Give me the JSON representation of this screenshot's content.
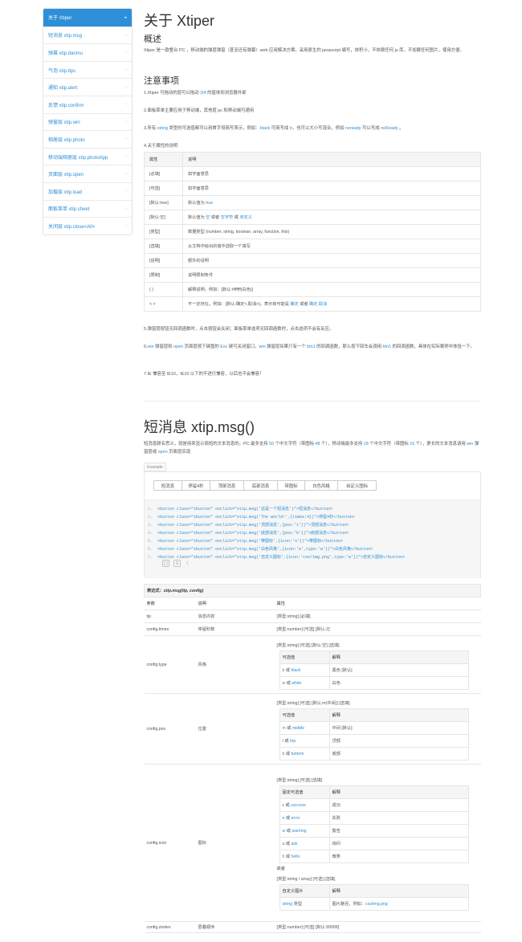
{
  "sidebar": {
    "items": [
      {
        "label": "关于 Xtiper",
        "active": true
      },
      {
        "label": "短消息 xtip.msg"
      },
      {
        "label": "弹幕 xtip.danmu"
      },
      {
        "label": "气泡 xtip.tips"
      },
      {
        "label": "通知 xtip.alert"
      },
      {
        "label": "反馈 xtip.confirm"
      },
      {
        "label": "弹窗层 xtip.win"
      },
      {
        "label": "相册层 xtip.photo"
      },
      {
        "label": "移动端相册层 xtip.photoApp"
      },
      {
        "label": "页面层 xtip.open"
      },
      {
        "label": "加载层 xtip.load"
      },
      {
        "label": "面板菜单 xtip.sheet"
      },
      {
        "label": "关闭层 xtip.close<All>"
      }
    ],
    "chevron": "chevron-right-icon"
  },
  "about": {
    "title": "关于 Xtiper",
    "overview_heading": "概述",
    "overview_text": "Xtiper 是一款整合 PC ，移动端的弹层弹窗（甚至还有弹幕）web 应用解决方案。采用原生的 javascript 编写，体积小，不依赖任何 js 库，不加载任何图片，使用方便。",
    "notes_heading": "注意事项",
    "note1_a": "1.Xtiper 可拖动的层可以拖动 ",
    "note1_b": "3/4",
    "note1_c": " 的窗体到浏览器外部",
    "note2": "2.面板菜单主要应用于移动端，其他层 pc 和移动端可通用",
    "note3_a": "3.所有 ",
    "note3_b": "string",
    "note3_c": " 类型的可选值都可以用首字母简写表示，例如：",
    "note3_d": "black",
    "note3_e": " 可简写成 ",
    "note3_f": "b",
    "note3_g": "，也可以大小写混合，例如 ",
    "note3_h": "noready",
    "note3_i": " 可以写成 ",
    "note3_j": "noReady",
    "note3_k": " 。",
    "note4": "4.关于属性的说明",
    "props_header": [
      "属性",
      "说明"
    ],
    "props": [
      {
        "k": "[必填]",
        "v": "如字面意思"
      },
      {
        "k": "[可选]",
        "v": "如字面意思"
      },
      {
        "k": "[默认:true]",
        "v_pre": "默认值为 ",
        "v_link": "true"
      },
      {
        "k": "[默认:空]",
        "v_pre": "默认值为 ",
        "v_link": "空",
        "v_mid": " 或者 ",
        "v_link2": "空字符",
        "v_mid2": " 或 ",
        "v_link3": "未定义"
      },
      {
        "k": "[类型]",
        "v": "数据类型 (number, string, boolean, array, function, this)"
      },
      {
        "k": "[选填]",
        "v": "从文档中给出的值中选取一个填写"
      },
      {
        "k": "[说明]",
        "v": "额外的说明"
      },
      {
        "k": "[限制]",
        "v": "说明限制条件"
      },
      {
        "k": "( )",
        "v": "解释说明，例如：[默认:#ffffff(白色)]"
      },
      {
        "k": "< >",
        "v_pre": "不一定存在。例如：[默认:确定<,取消>]，表示有可能是 ",
        "v_link": "确定",
        "v_mid": " 或者 ",
        "v_link2": "确定,取消"
      }
    ],
    "note5": "5.弹窗层按钮无回调函数时，点击按钮会关闭；面板菜单选项无回调函数时，点击选项不会有反应。",
    "note6_a": "6.",
    "note6_b": "win",
    "note6_c": " 弹窗层和 ",
    "note6_d": "open",
    "note6_e": " 页面层按下键盘的 ",
    "note6_f": "Esc",
    "note6_g": " 键可关闭窗口，",
    "note6_h": "win",
    "note6_i": " 弹窗层如果只有一个 ",
    "note6_j": "btn1",
    "note6_k": " 的回调函数，那么按下回车会调用 ",
    "note6_l": "btn1",
    "note6_m": " 的回调函数，具体在实际案例中体验一下。",
    "note7": "7.IE 兼容至 IE10，IE10 以下的不进行兼容，以后也不会兼容！"
  },
  "msg": {
    "title": "短消息 xtip.msg()",
    "desc_a": "短消息顾名思义，就是用来显示简短的文本消息的。PC 最多支持 ",
    "desc_b": "50",
    "desc_c": " 个中文字符（带图标 ",
    "desc_d": "48",
    "desc_e": " 个），移动端最多支持 ",
    "desc_f": "18",
    "desc_g": " 个中文字符（带图标 ",
    "desc_h": "16",
    "desc_i": " 个），更长的文本消息请用 ",
    "desc_j": "win",
    "desc_k": " 弹窗层或 ",
    "desc_l": "open",
    "desc_m": " 页面层实现",
    "example_label": "Example",
    "buttons": [
      "短消息",
      "停留4秒",
      "顶部消息",
      "底部消息",
      "带图标",
      "白色风格",
      "自定义图标"
    ],
    "code": [
      "<button class=\"xbutton\" onclick=\"xtip.msg('这是一个短消息')\">短消息</button>",
      "<button class=\"xbutton\" onclick=\"xtip.msg('The world!',{times:4})\">停留4秒</button>",
      "<button class=\"xbutton\" onclick=\"xtip.msg('顶部消息',{pos:'t'})\">顶部消息</button>",
      "<button class=\"xbutton\" onclick=\"xtip.msg('底部消息',{pos:'b'})\">底部消息</button>",
      "<button class=\"xbutton\" onclick=\"xtip.msg('带图标',{icon:'s'})\">带图标</button>",
      "<button class=\"xbutton\" onclick=\"xtip.msg('白色风格',{icon:'e',type:'w'})\">白色风格</button>",
      "<button class=\"xbutton\" onclick=\"xtip.msg('自定义图标',{icon:'css/img.png',type:'w'})\">自定义图标</button>"
    ],
    "tools": [
      "copy-icon",
      "expand-icon",
      "theme-icon"
    ],
    "expr_label": "表达式：",
    "expr": "xtip.msg(tip, config)",
    "param_header": [
      "参数",
      "说明",
      "属性"
    ],
    "params": {
      "tip": {
        "k": "tip",
        "d": "消息内容",
        "a": "[类型:string] [必填]"
      },
      "times": {
        "k": "config.times",
        "d": "停留秒数",
        "a": "[类型:number] [可选] [默认:2]"
      },
      "type": {
        "k": "config.type",
        "d": "风格",
        "a": "[类型:string] [可选] [默认:空] [选填]",
        "ih": [
          "可选值",
          "解释"
        ],
        "rows": [
          {
            "c1a": "b",
            "c1b": " 或 ",
            "c1c": "black",
            "c2": "黑色 [默认]"
          },
          {
            "c1a": "w",
            "c1b": " 或 ",
            "c1c": "white",
            "c2": "白色"
          }
        ]
      },
      "pos": {
        "k": "config.pos",
        "d": "位置",
        "a": "[类型:string] [可选] [默认:m(中间)] [选填]",
        "ih": [
          "可选值",
          "解释"
        ],
        "rows": [
          {
            "c1a": "m",
            "c1b": " 或 ",
            "c1c": "middle",
            "c2": "中间 [默认]"
          },
          {
            "c1a": "t",
            "c1b": " 或 ",
            "c1c": "top",
            "c2": "顶部"
          },
          {
            "c1a": "b",
            "c1b": " 或 ",
            "c1c": "bottom",
            "c2": "底部"
          }
        ]
      },
      "icon": {
        "k": "config.icon",
        "d": "图标",
        "a": "[类型:string] [可选] [选填]",
        "ih": [
          "固定可选值",
          "解释"
        ],
        "rows": [
          {
            "c1a": "s",
            "c1b": " 或 ",
            "c1c": "success",
            "c2": "成功"
          },
          {
            "c1a": "e",
            "c1b": " 或 ",
            "c1c": "error",
            "c2": "失败"
          },
          {
            "c1a": "w",
            "c1b": " 或 ",
            "c1c": "warning",
            "c2": "警告"
          },
          {
            "c1a": "a",
            "c1b": " 或 ",
            "c1c": "ask",
            "c2": "询问"
          },
          {
            "c1a": "h",
            "c1b": " 或 ",
            "c1c": "hello",
            "c2": "微笑"
          }
        ],
        "or": "或者",
        "a2": "[类型:string / array] [可选] [选填]",
        "ih2": [
          "自定义图片",
          "解释"
        ],
        "row2": {
          "c1a": "string",
          "c1b": " 类型",
          "c2a": "图片路径，例如：",
          "c2b": "css/img.png"
        }
      },
      "zindex": {
        "k": "config.zindex",
        "d": "层叠顺序",
        "a": "[类型:number] [可选] [默认:99999]"
      }
    }
  }
}
